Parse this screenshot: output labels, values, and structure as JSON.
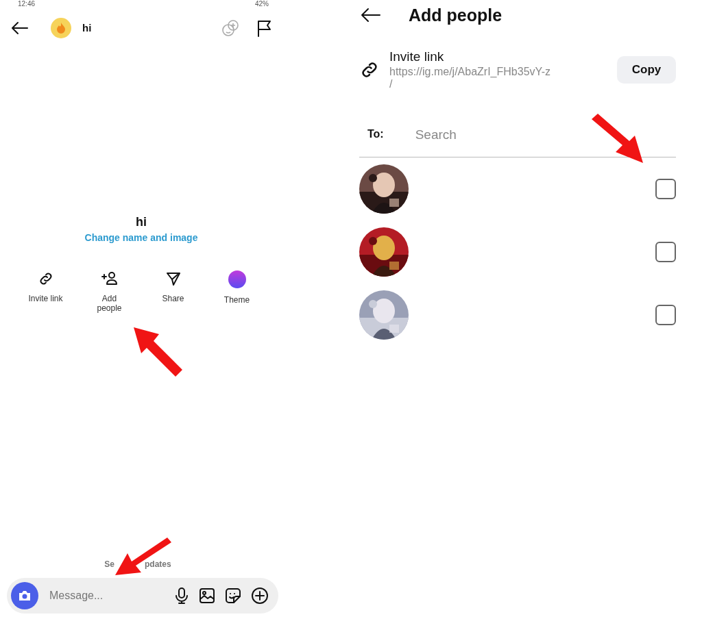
{
  "status_bar": {
    "time": "12:46",
    "battery": "42%"
  },
  "chat": {
    "header": {
      "title": "hi"
    },
    "group_name": "hi",
    "change_link": "Change name and image",
    "actions": [
      {
        "kind": "link",
        "label": "Invite link"
      },
      {
        "kind": "add",
        "label": "Add\npeople"
      },
      {
        "kind": "share",
        "label": "Share"
      },
      {
        "kind": "theme",
        "label": "Theme"
      }
    ],
    "updates_parts": [
      "Se",
      "pdates"
    ],
    "composer": {
      "placeholder": "Message..."
    }
  },
  "add_people": {
    "title": "Add people",
    "invite": {
      "label": "Invite link",
      "url": "https://ig.me/j/AbaZrI_FHb35vY-z\n/",
      "button": "Copy"
    },
    "to_label": "To:",
    "search": {
      "placeholder": "Search"
    }
  }
}
